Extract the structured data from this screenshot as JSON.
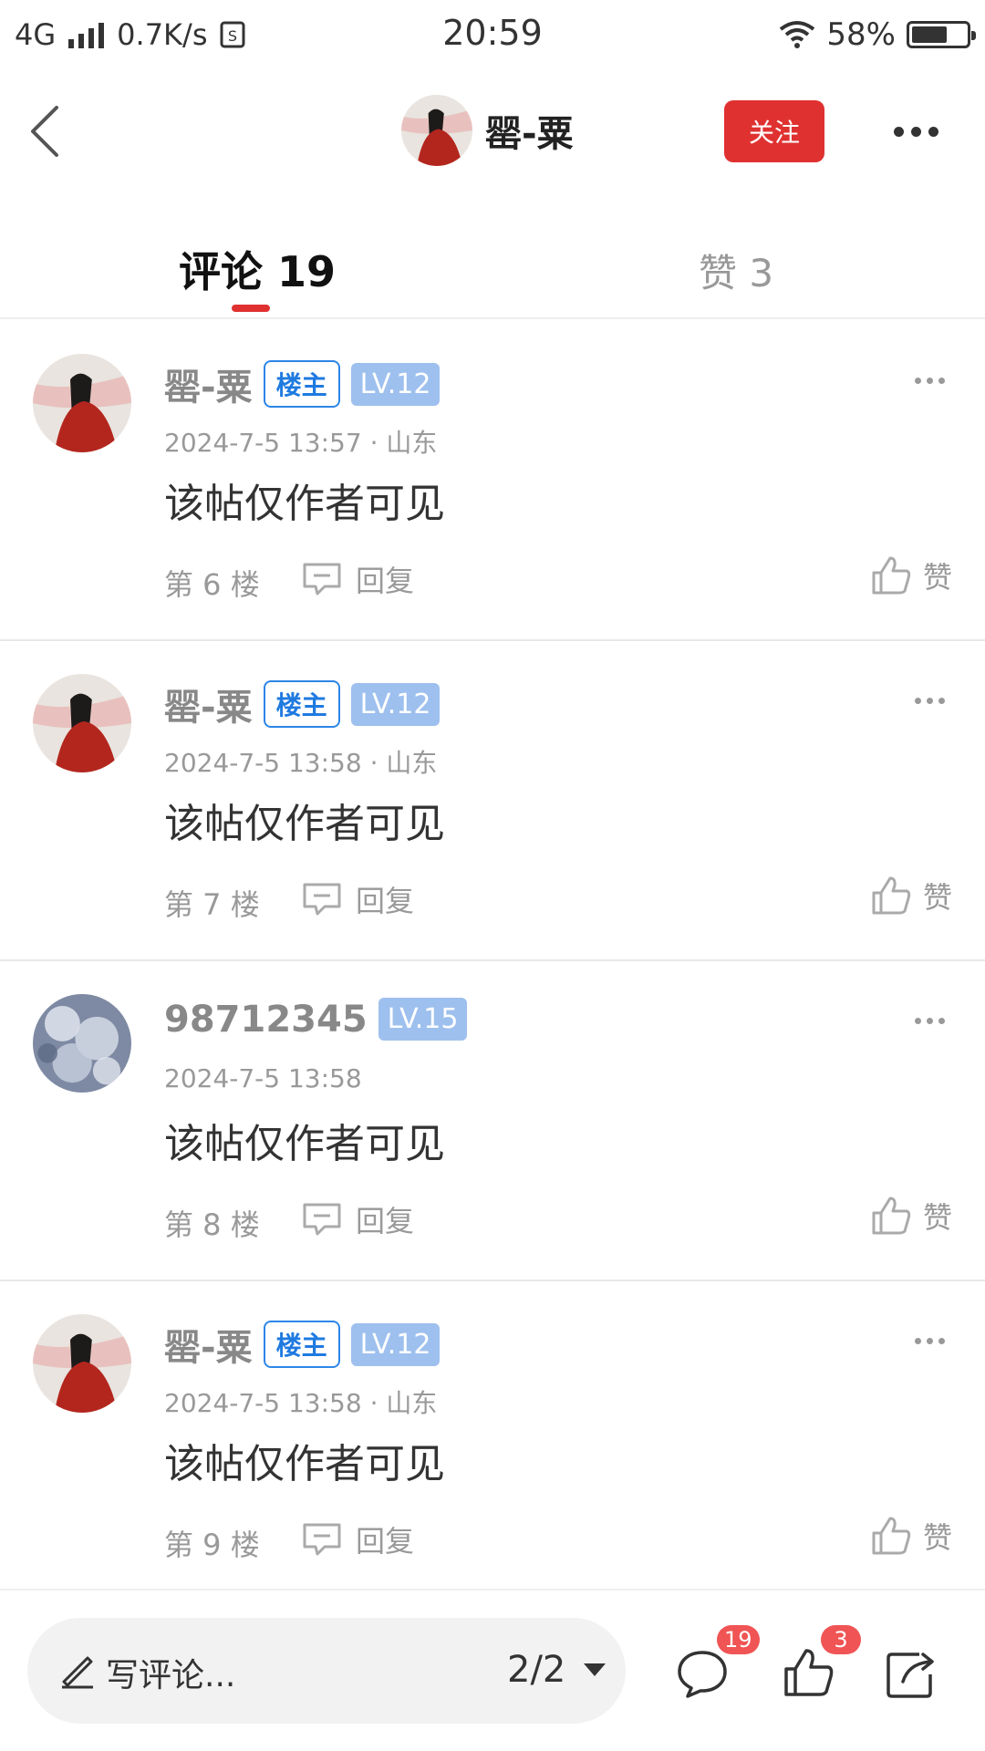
{
  "status_bar": {
    "network": "4G",
    "speed": "0.7K/s",
    "time": "20:59",
    "battery": "58%"
  },
  "header": {
    "author_name": "罂-粟",
    "follow_label": "关注"
  },
  "tabs": [
    {
      "label": "评论 19",
      "active": true
    },
    {
      "label": "赞 3",
      "active": false
    }
  ],
  "comments": [
    {
      "user": "罂-粟",
      "host_badge": "楼主",
      "level": "LV.12",
      "time_location": "2024-7-5 13:57 · 山东",
      "content": "该帖仅作者可见",
      "floor": "第 6 楼",
      "reply_label": "回复",
      "like_label": "赞"
    },
    {
      "user": "罂-粟",
      "host_badge": "楼主",
      "level": "LV.12",
      "time_location": "2024-7-5 13:58 · 山东",
      "content": "该帖仅作者可见",
      "floor": "第 7 楼",
      "reply_label": "回复",
      "like_label": "赞"
    },
    {
      "user": "98712345",
      "host_badge": "",
      "level": "LV.15",
      "time_location": "2024-7-5 13:58",
      "content": "该帖仅作者可见",
      "floor": "第 8 楼",
      "reply_label": "回复",
      "like_label": "赞"
    },
    {
      "user": "罂-粟",
      "host_badge": "楼主",
      "level": "LV.12",
      "time_location": "2024-7-5 13:58 · 山东",
      "content": "该帖仅作者可见",
      "floor": "第 9 楼",
      "reply_label": "回复",
      "like_label": "赞"
    }
  ],
  "bottom_bar": {
    "compose_placeholder": "写评论...",
    "page_indicator": "2/2",
    "comment_count": "19",
    "like_count": "3"
  },
  "colors": {
    "accent_red": "#e03131",
    "host_blue": "#1f7ae0",
    "level_blue": "#9ec0ee"
  }
}
